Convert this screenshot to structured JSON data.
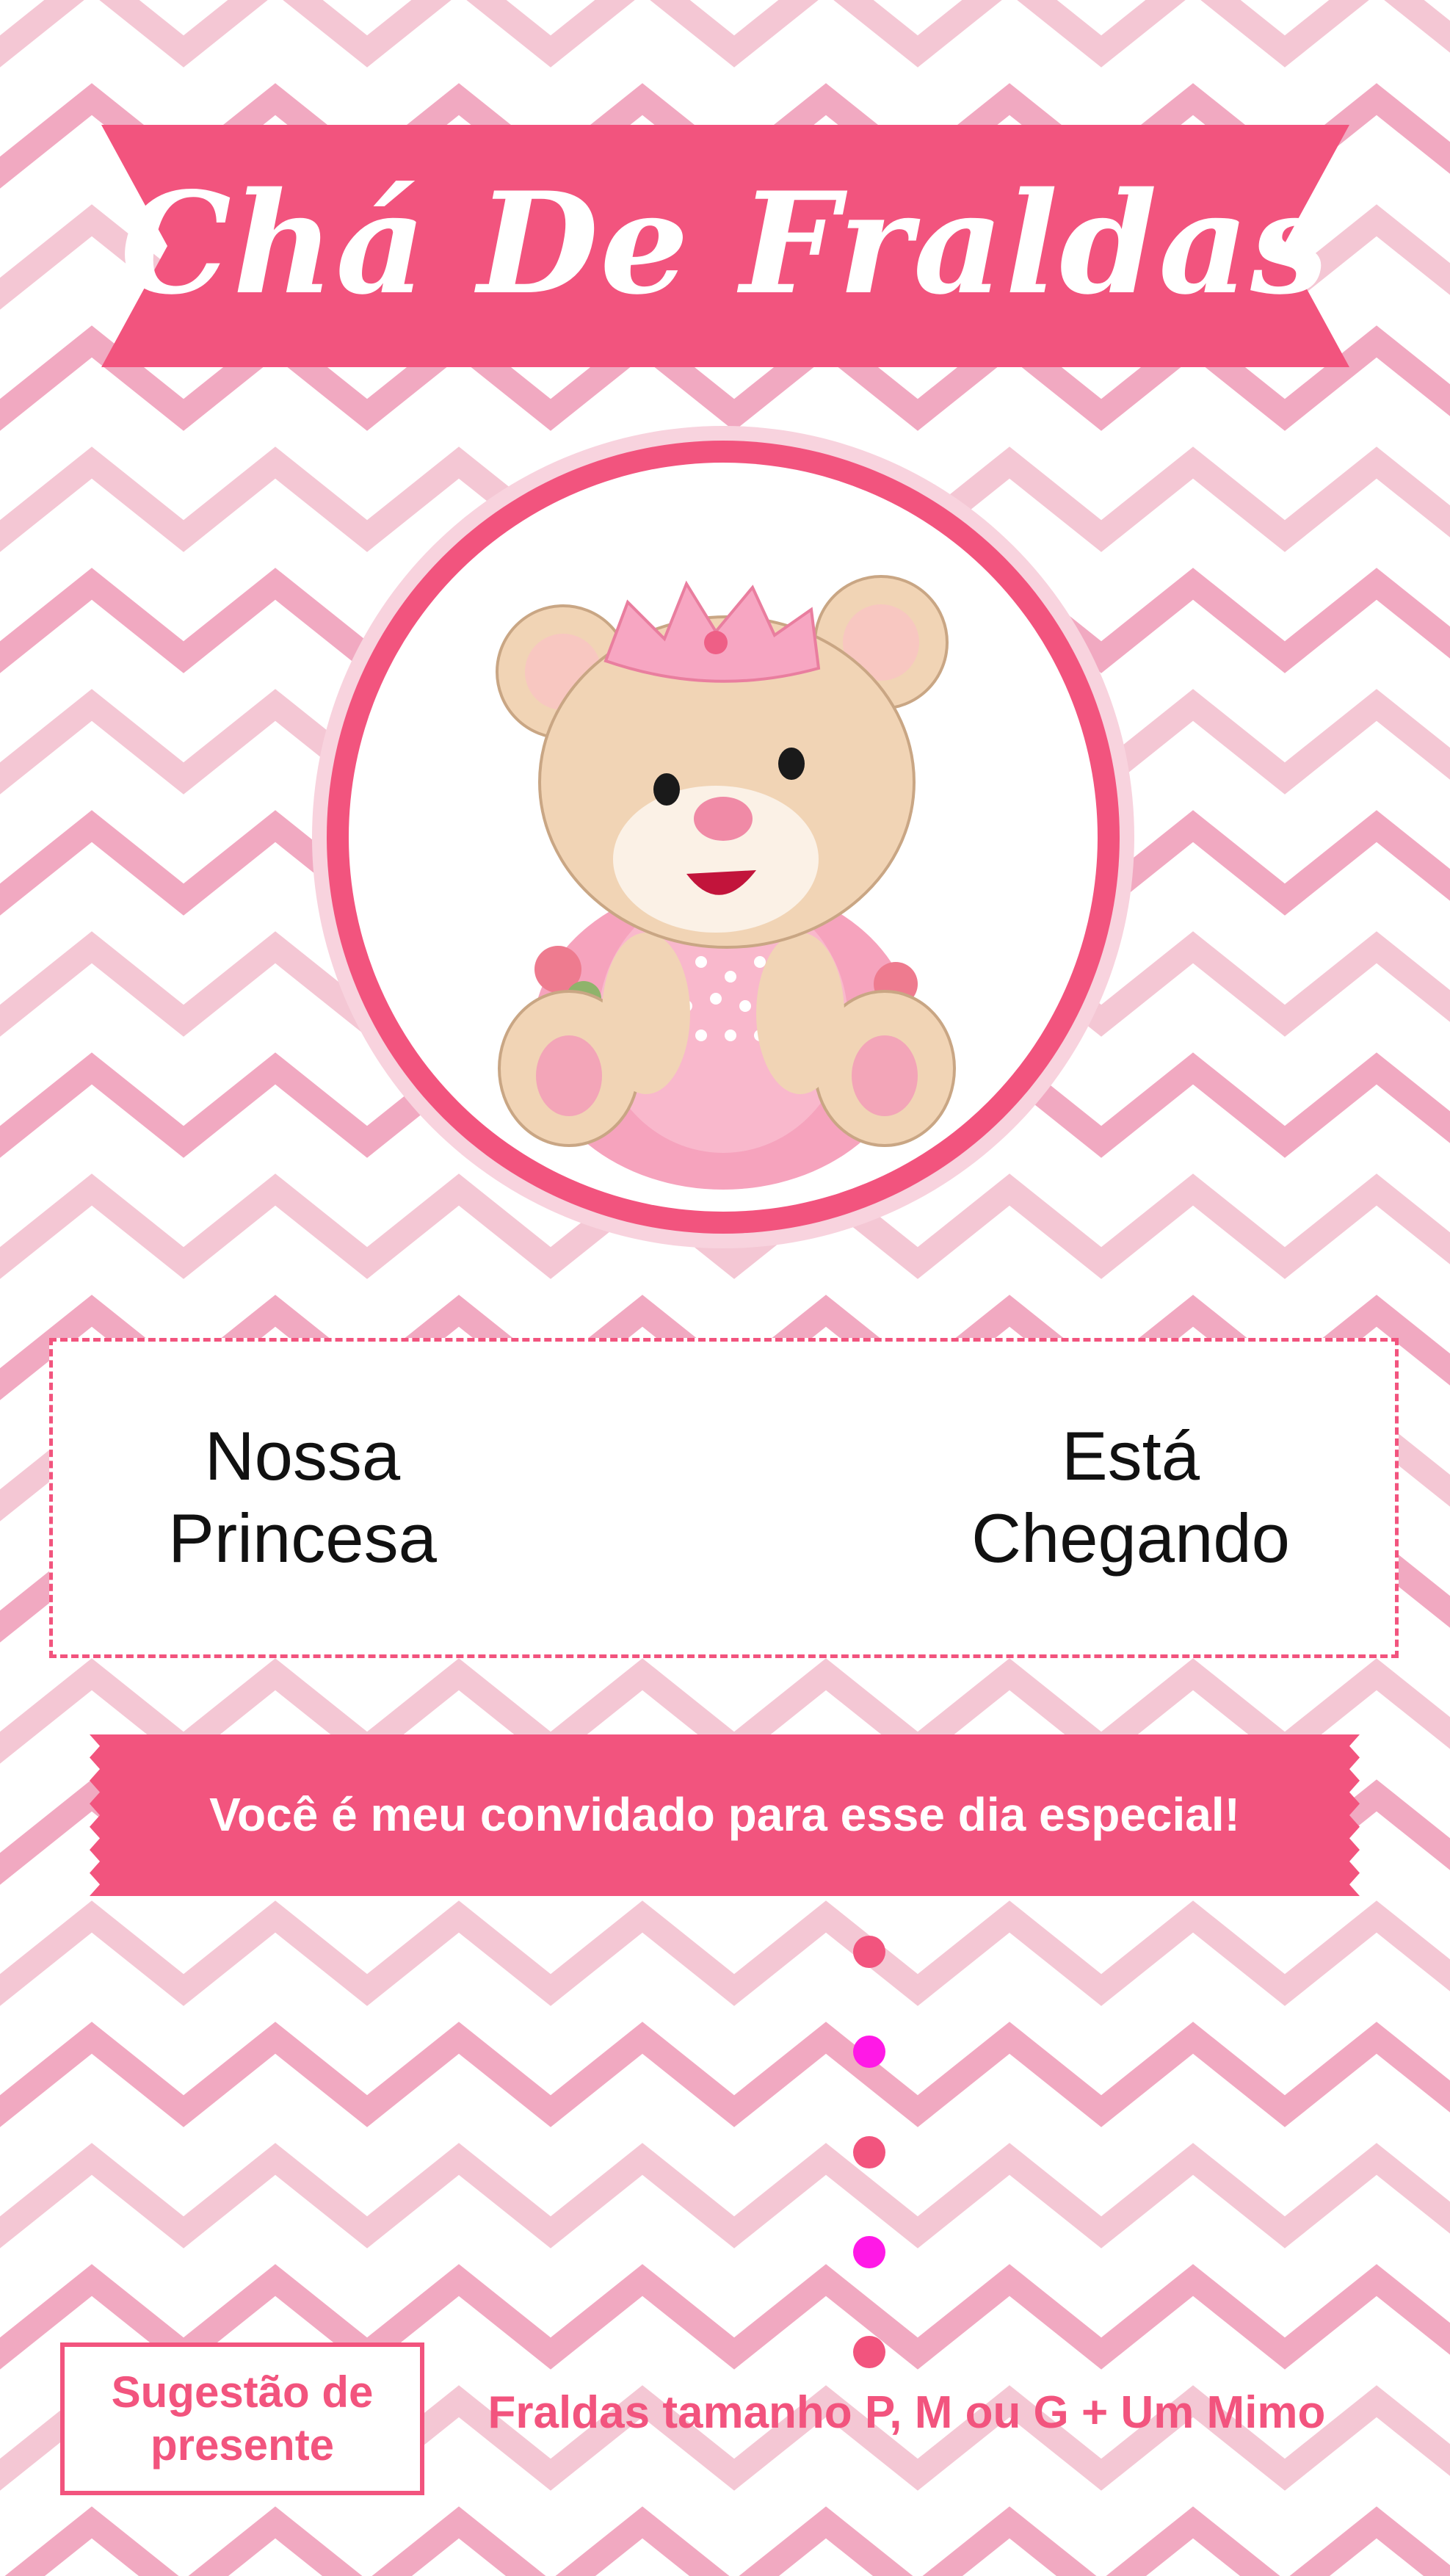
{
  "banner": {
    "title": "Chá De Fraldas"
  },
  "medallion": {
    "illustration": "teddy-bear-princess-icon"
  },
  "message": {
    "left": "Nossa\nPrincesa",
    "right": "Está\nChegando"
  },
  "invite": {
    "text": "Você é meu convidado para esse dia especial!"
  },
  "gift": {
    "label": "Sugestão de\npresente",
    "text": "Fraldas tamanho P, M ou G + Um Mimo"
  },
  "colors": {
    "accent": "#f2547e",
    "chevron_light": "#f4c7d4",
    "dot_pink": "#f2547e",
    "dot_magenta": "#ff19e6"
  },
  "dots": [
    "pink",
    "magenta",
    "pink",
    "magenta",
    "pink"
  ]
}
